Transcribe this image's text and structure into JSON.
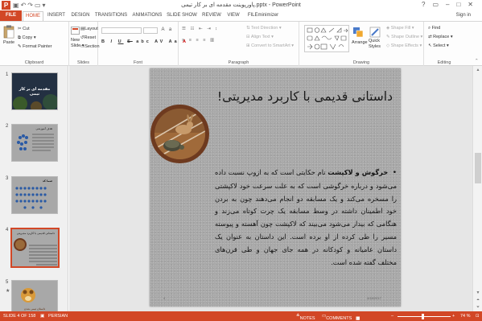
{
  "titlebar": {
    "title": "پاورپوینت مقدمه ای بر کار تیمی.pptx - PowerPoint",
    "app_icon": "P",
    "qat_icons": [
      "save-icon",
      "undo-icon",
      "redo-icon",
      "start-slideshow-icon",
      "customize-icon"
    ],
    "window_buttons": [
      "help-icon",
      "ribbon-display-icon",
      "minimize-icon",
      "maximize-icon",
      "close-icon"
    ]
  },
  "tabs": [
    {
      "label": "FILE"
    },
    {
      "label": "HOME"
    },
    {
      "label": "INSERT"
    },
    {
      "label": "DESIGN"
    },
    {
      "label": "TRANSITIONS"
    },
    {
      "label": "ANIMATIONS"
    },
    {
      "label": "SLIDE SHOW"
    },
    {
      "label": "REVIEW"
    },
    {
      "label": "VIEW"
    },
    {
      "label": "FILEminimizer"
    }
  ],
  "signin": "Sign in",
  "ribbon": {
    "clipboard": {
      "label": "Clipboard",
      "paste": "Paste",
      "cut": "Cut",
      "copy": "Copy",
      "format_painter": "Format Painter"
    },
    "slides": {
      "label": "Slides",
      "new_slide": "New",
      "new_slide_2": "Slide",
      "layout": "Layout",
      "reset": "Reset",
      "section": "Section"
    },
    "font": {
      "label": "Font",
      "bold": "B",
      "italic": "I",
      "underline": "U",
      "strike": "S",
      "shadow": "abc",
      "spacing": "AV",
      "case": "Aa",
      "color": "A"
    },
    "paragraph": {
      "label": "Paragraph",
      "text_direction": "Text Direction",
      "align_text": "Align Text",
      "convert_smartart": "Convert to SmartArt"
    },
    "drawing": {
      "label": "Drawing",
      "arrange": "Arrange",
      "quick_styles": "Quick",
      "quick_styles_2": "Styles",
      "shape_fill": "Shape Fill",
      "shape_outline": "Shape Outline",
      "shape_effects": "Shape Effects"
    },
    "editing": {
      "label": "Editing",
      "find": "Find",
      "replace": "Replace",
      "select": "Select"
    }
  },
  "thumbnails": [
    {
      "num": "1",
      "title": "مقدمه ای بر کار تیمی"
    },
    {
      "num": "2",
      "title": "هدف آموزشی"
    },
    {
      "num": "3",
      "title": "شما کد"
    },
    {
      "num": "4",
      "title": "داستانی قدیمی با کاربرد مدیریتی"
    },
    {
      "num": "5",
      "title": "داستان تیمی شدن",
      "star": "★"
    }
  ],
  "slide": {
    "title": "داستانی قدیمی با کاربرد مدیریتی!",
    "bullet": "•",
    "body_bold": "خرگوش و لاکپشت",
    "body_text": " نام حکایتی است که به ازوپ نسبت داده می‌شود و درباره خرگوشی است که به علت سرعت خود لاکپشتی را مسخره می‌کند و یک مسابقه دو انجام می‌دهند چون به بردن خود اطمینان داشته در وسط مسابقه یک چرت کوتاه می‌زند و هنگامی که بیدار می‌شود می‌بیند که لاکپشت چون آهسته و پیوسته مسیر را طی کرده از او برده است. این داستان به عنوان یک داستان عامیانه و کودکانه در همه جای جهان و طی قرن‌های مختلف گفته شده است.",
    "date": "4/18/2017",
    "page_num": "4"
  },
  "statusbar": {
    "slide_info": "SLIDE 4 OF 158",
    "language": "PERSIAN",
    "notes": "NOTES",
    "comments": "COMMENTS",
    "zoom": "74 %"
  },
  "colors": {
    "accent": "#d24726",
    "slide_bg": "#a9a9a9"
  }
}
